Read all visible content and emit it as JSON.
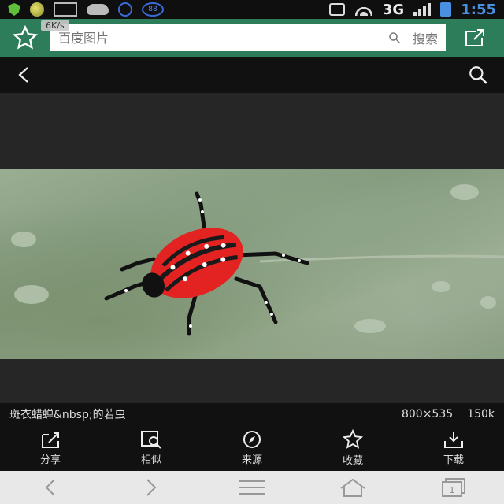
{
  "status_bar": {
    "network": "3G",
    "time": "1:55",
    "badge_88": "88",
    "speed": "6K/s",
    "icons": [
      "shield-icon",
      "coin-icon",
      "image-icon",
      "cloud-icon",
      "ring-icon",
      "badge-icon",
      "vibrate-icon",
      "wifi-icon",
      "signal-icon",
      "battery-icon"
    ]
  },
  "browser": {
    "search_placeholder": "百度图片",
    "search_button": "搜索",
    "accent": "#2e7d5a"
  },
  "viewer": {
    "caption": "斑衣蜡蝉&nbsp;的若虫",
    "dimensions": "800×535",
    "size": "150k"
  },
  "actions": [
    {
      "label": "分享",
      "icon": "share-icon"
    },
    {
      "label": "相似",
      "icon": "similar-search-icon"
    },
    {
      "label": "来源",
      "icon": "compass-icon"
    },
    {
      "label": "收藏",
      "icon": "star-icon"
    },
    {
      "label": "下载",
      "icon": "download-icon"
    }
  ],
  "nav": [
    "back-icon",
    "forward-icon",
    "menu-icon",
    "home-icon",
    "tabs-icon"
  ],
  "nav_tabs_count": "1"
}
